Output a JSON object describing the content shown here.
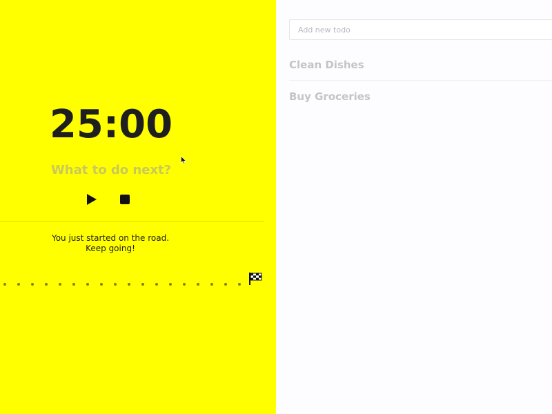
{
  "timer": {
    "time": "25:00",
    "task_prompt": "What to do next?",
    "message_line1": "You just started on the road.",
    "message_line2": "Keep going!",
    "road_progress": 0
  },
  "todos": {
    "input_placeholder": "Add new todo",
    "input_value": "",
    "items": [
      {
        "label": "Clean Dishes"
      },
      {
        "label": "Buy Groceries"
      }
    ]
  },
  "colors": {
    "timer_background": "#ffff00",
    "todo_background": "#fdfdff",
    "text_dark": "#1f1f1f",
    "muted_label": "#c9c95a",
    "todo_text": "#c4c4c8"
  },
  "icons": {
    "play": "play-icon",
    "stop": "stop-icon",
    "finish": "checkered-flag-icon",
    "cursor": "mouse-pointer-icon"
  }
}
